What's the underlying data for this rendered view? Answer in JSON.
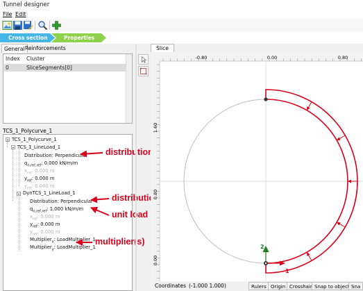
{
  "window": {
    "title": "Tunnel designer"
  },
  "menu": [
    "File",
    "Edit"
  ],
  "toolbar": {
    "icons": [
      "new-icon",
      "save-icon",
      "save-as-icon",
      "search-icon",
      "add-icon"
    ]
  },
  "breadcrumb": [
    "Cross section",
    "Properties"
  ],
  "left_tabs": [
    "General",
    "Reinforcements"
  ],
  "table": {
    "columns": [
      "Index",
      "Cluster"
    ],
    "rows": [
      [
        "0",
        "SliceSegments[0]"
      ]
    ]
  },
  "tree_title": "TCS_1_Polycurve_1",
  "tree": {
    "root": "TCS_1_Polycurve_1",
    "lineload": {
      "name": "TCS_1_LineLoad_1",
      "distribution": "Distribution: Perpendicular",
      "q_label": "q",
      "q_sub": "n,ref,ref",
      "q_value": ": 0.000 kN/m/m",
      "x_label": "x",
      "x_sub": "ref",
      "x_value": ": 0.000 m",
      "y_label": "y",
      "y_sub": "ref",
      "y_value": ": 0.000 m",
      "y2_label": "y",
      "y2_sub": "ref",
      "y2_value": ": 0.000 m"
    },
    "dynload": {
      "name": "DynTCS_1_LineLoad_1",
      "distribution": "Distribution: Perpendicular",
      "q_label": "q",
      "q_sub": "n,ref,ref",
      "q_value": ": 1.000 kN/m/m",
      "x_label": "x",
      "x_sub": "ref",
      "x_value": ": 0.000 m",
      "y_label": "y",
      "y_sub": "ref",
      "y_value": ": 0.000 m",
      "y2_label": "y",
      "y2_sub": "ref",
      "y2_value": ": 0.000 m",
      "mult_x_label": "Multiplier",
      "mult_x_sub": "x",
      "mult_x_value": ": LoadMultiplier_1",
      "mult_y_label": "Multiplier",
      "mult_y_sub": "y",
      "mult_y_value": ": LoadMultiplier_1"
    }
  },
  "annotations": [
    "distribution",
    "distribution",
    "unit load",
    "multiplier(s)"
  ],
  "slice": {
    "tab": "Slice",
    "ruler_top": [
      "-0.80",
      "0.00",
      "0.80"
    ],
    "ruler_left": [
      "1.60",
      "0.80",
      "0.00"
    ],
    "axis_labels": {
      "y": "2",
      "x": "1"
    }
  },
  "status": {
    "coords_label": "Coordinates",
    "coords_value": "(-1.000 1.000)",
    "buttons": [
      "Rulers",
      "Origin",
      "Crosshair",
      "Snap to object",
      "Sna"
    ]
  },
  "colors": {
    "load": "#d9001b",
    "accent_green": "#1e7d1e",
    "annotation": "#d9001b",
    "tab_blue": "#45b6e6",
    "tab_green": "#8ed14b"
  }
}
